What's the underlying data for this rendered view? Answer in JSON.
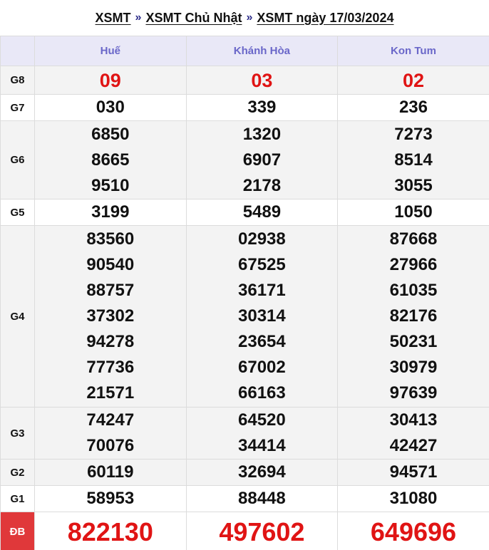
{
  "breadcrumb": {
    "items": [
      "XSMT",
      "XSMT Chủ Nhật",
      "XSMT ngày 17/03/2024"
    ],
    "separator": "»"
  },
  "provinces": [
    "Huế",
    "Khánh Hòa",
    "Kon Tum"
  ],
  "prizes": [
    {
      "label": "G8",
      "values": [
        [
          "09"
        ],
        [
          "03"
        ],
        [
          "02"
        ]
      ]
    },
    {
      "label": "G7",
      "values": [
        [
          "030"
        ],
        [
          "339"
        ],
        [
          "236"
        ]
      ]
    },
    {
      "label": "G6",
      "values": [
        [
          "6850",
          "8665",
          "9510"
        ],
        [
          "1320",
          "6907",
          "2178"
        ],
        [
          "7273",
          "8514",
          "3055"
        ]
      ]
    },
    {
      "label": "G5",
      "values": [
        [
          "3199"
        ],
        [
          "5489"
        ],
        [
          "1050"
        ]
      ]
    },
    {
      "label": "G4",
      "values": [
        [
          "83560",
          "90540",
          "88757",
          "37302",
          "94278",
          "77736",
          "21571"
        ],
        [
          "02938",
          "67525",
          "36171",
          "30314",
          "23654",
          "67002",
          "66163"
        ],
        [
          "87668",
          "27966",
          "61035",
          "82176",
          "50231",
          "30979",
          "97639"
        ]
      ]
    },
    {
      "label": "G3",
      "values": [
        [
          "74247",
          "70076"
        ],
        [
          "64520",
          "34414"
        ],
        [
          "30413",
          "42427"
        ]
      ]
    },
    {
      "label": "G2",
      "values": [
        [
          "60119"
        ],
        [
          "32694"
        ],
        [
          "94571"
        ]
      ]
    },
    {
      "label": "G1",
      "values": [
        [
          "58953"
        ],
        [
          "88448"
        ],
        [
          "31080"
        ]
      ]
    },
    {
      "label": "ĐB",
      "values": [
        [
          "822130"
        ],
        [
          "497602"
        ],
        [
          "649696"
        ]
      ]
    }
  ],
  "colors": {
    "header_bg": "#e9e8f7",
    "header_text": "#6a67c9",
    "highlight_red": "#e01414",
    "db_label_bg": "#e0383a"
  }
}
